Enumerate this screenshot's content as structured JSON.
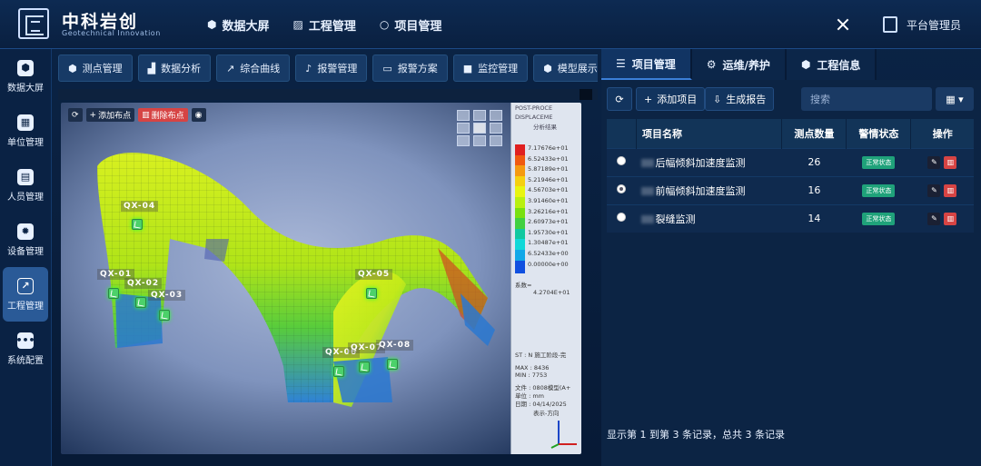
{
  "brand": {
    "name_cn": "中科岩创",
    "name_en": "Geotechnical Innovation"
  },
  "top_nav": [
    {
      "icon": "cube-icon",
      "label": "数据大屏"
    },
    {
      "icon": "chart-icon",
      "label": "工程管理"
    },
    {
      "icon": "circle-icon",
      "label": "项目管理"
    }
  ],
  "user": {
    "name": "平台管理员"
  },
  "sidebar": [
    {
      "icon": "cube-icon",
      "label": "数据大屏"
    },
    {
      "icon": "calendar-icon",
      "label": "单位管理"
    },
    {
      "icon": "id-card-icon",
      "label": "人员管理"
    },
    {
      "icon": "gear-icon",
      "label": "设备管理"
    },
    {
      "icon": "chart-icon",
      "label": "工程管理",
      "active": true
    },
    {
      "icon": "dots-icon",
      "label": "系统配置"
    }
  ],
  "module_tabs": [
    {
      "icon": "cubes-icon",
      "label": "测点管理"
    },
    {
      "icon": "area-chart-icon",
      "label": "数据分析"
    },
    {
      "icon": "line-chart-icon",
      "label": "综合曲线"
    },
    {
      "icon": "bell-icon",
      "label": "报警管理"
    },
    {
      "icon": "book-icon",
      "label": "报警方案"
    },
    {
      "icon": "video-icon",
      "label": "监控管理"
    },
    {
      "icon": "cubes-icon",
      "label": "模型展示"
    }
  ],
  "viewer": {
    "add_label": "添加布点",
    "del_label": "删除布点",
    "points": [
      {
        "label": "QX-04"
      },
      {
        "label": "QX-01"
      },
      {
        "label": "QX-02"
      },
      {
        "label": "QX-03"
      },
      {
        "label": "QX-05"
      },
      {
        "label": "QX-06"
      },
      {
        "label": "QX-07"
      },
      {
        "label": "QX-08"
      }
    ],
    "legend": {
      "hdr1": "POST-PROCE",
      "hdr2": "DISPLACEME",
      "hdr3": "分析结果",
      "values": [
        "7.17676e+01",
        "6.52433e+01",
        "5.87189e+01",
        "5.21946e+01",
        "4.56703e+01",
        "3.91460e+01",
        "3.26216e+01",
        "2.60973e+01",
        "1.95730e+01",
        "1.30487e+01",
        "6.52433e+00",
        "0.00000e+00"
      ],
      "colors": [
        "#e02020",
        "#f05a10",
        "#f59a10",
        "#f5d010",
        "#e8f510",
        "#b8f010",
        "#78e010",
        "#40d040",
        "#10c8a0",
        "#10d8d8",
        "#10a8e8",
        "#1050e0"
      ],
      "scale_label": "系数=",
      "scale_value": "4.2704E+01",
      "stage_label": "ST : N 施工阶段-完",
      "max_label": "MAX : 8436",
      "min_label": "MIN : 7753",
      "file_label": "文件 : 0808模型(A+",
      "unit_label": "单位 : mm",
      "date_label": "日期 : 04/14/2025",
      "dir_label": "表示-方向"
    }
  },
  "right_tabs": [
    {
      "icon": "list-icon",
      "label": "项目管理"
    },
    {
      "icon": "gears-icon",
      "label": "运维/养护"
    },
    {
      "icon": "cubes-icon",
      "label": "工程信息"
    }
  ],
  "toolbar": {
    "add_label": "添加项目",
    "report_label": "生成报告",
    "search_placeholder": "搜索"
  },
  "table": {
    "headers": [
      "项目名称",
      "测点数量",
      "警情状态",
      "操作"
    ],
    "rows": [
      {
        "name": "后幅倾斜加速度监测",
        "count": "26",
        "status": "正常状态",
        "selected": false
      },
      {
        "name": "前幅倾斜加速度监测",
        "count": "16",
        "status": "正常状态",
        "selected": true
      },
      {
        "name": "裂缝监测",
        "count": "14",
        "status": "正常状态",
        "selected": false
      }
    ]
  },
  "footer": "显示第 1 到第 3 条记录，总共 3 条记录"
}
